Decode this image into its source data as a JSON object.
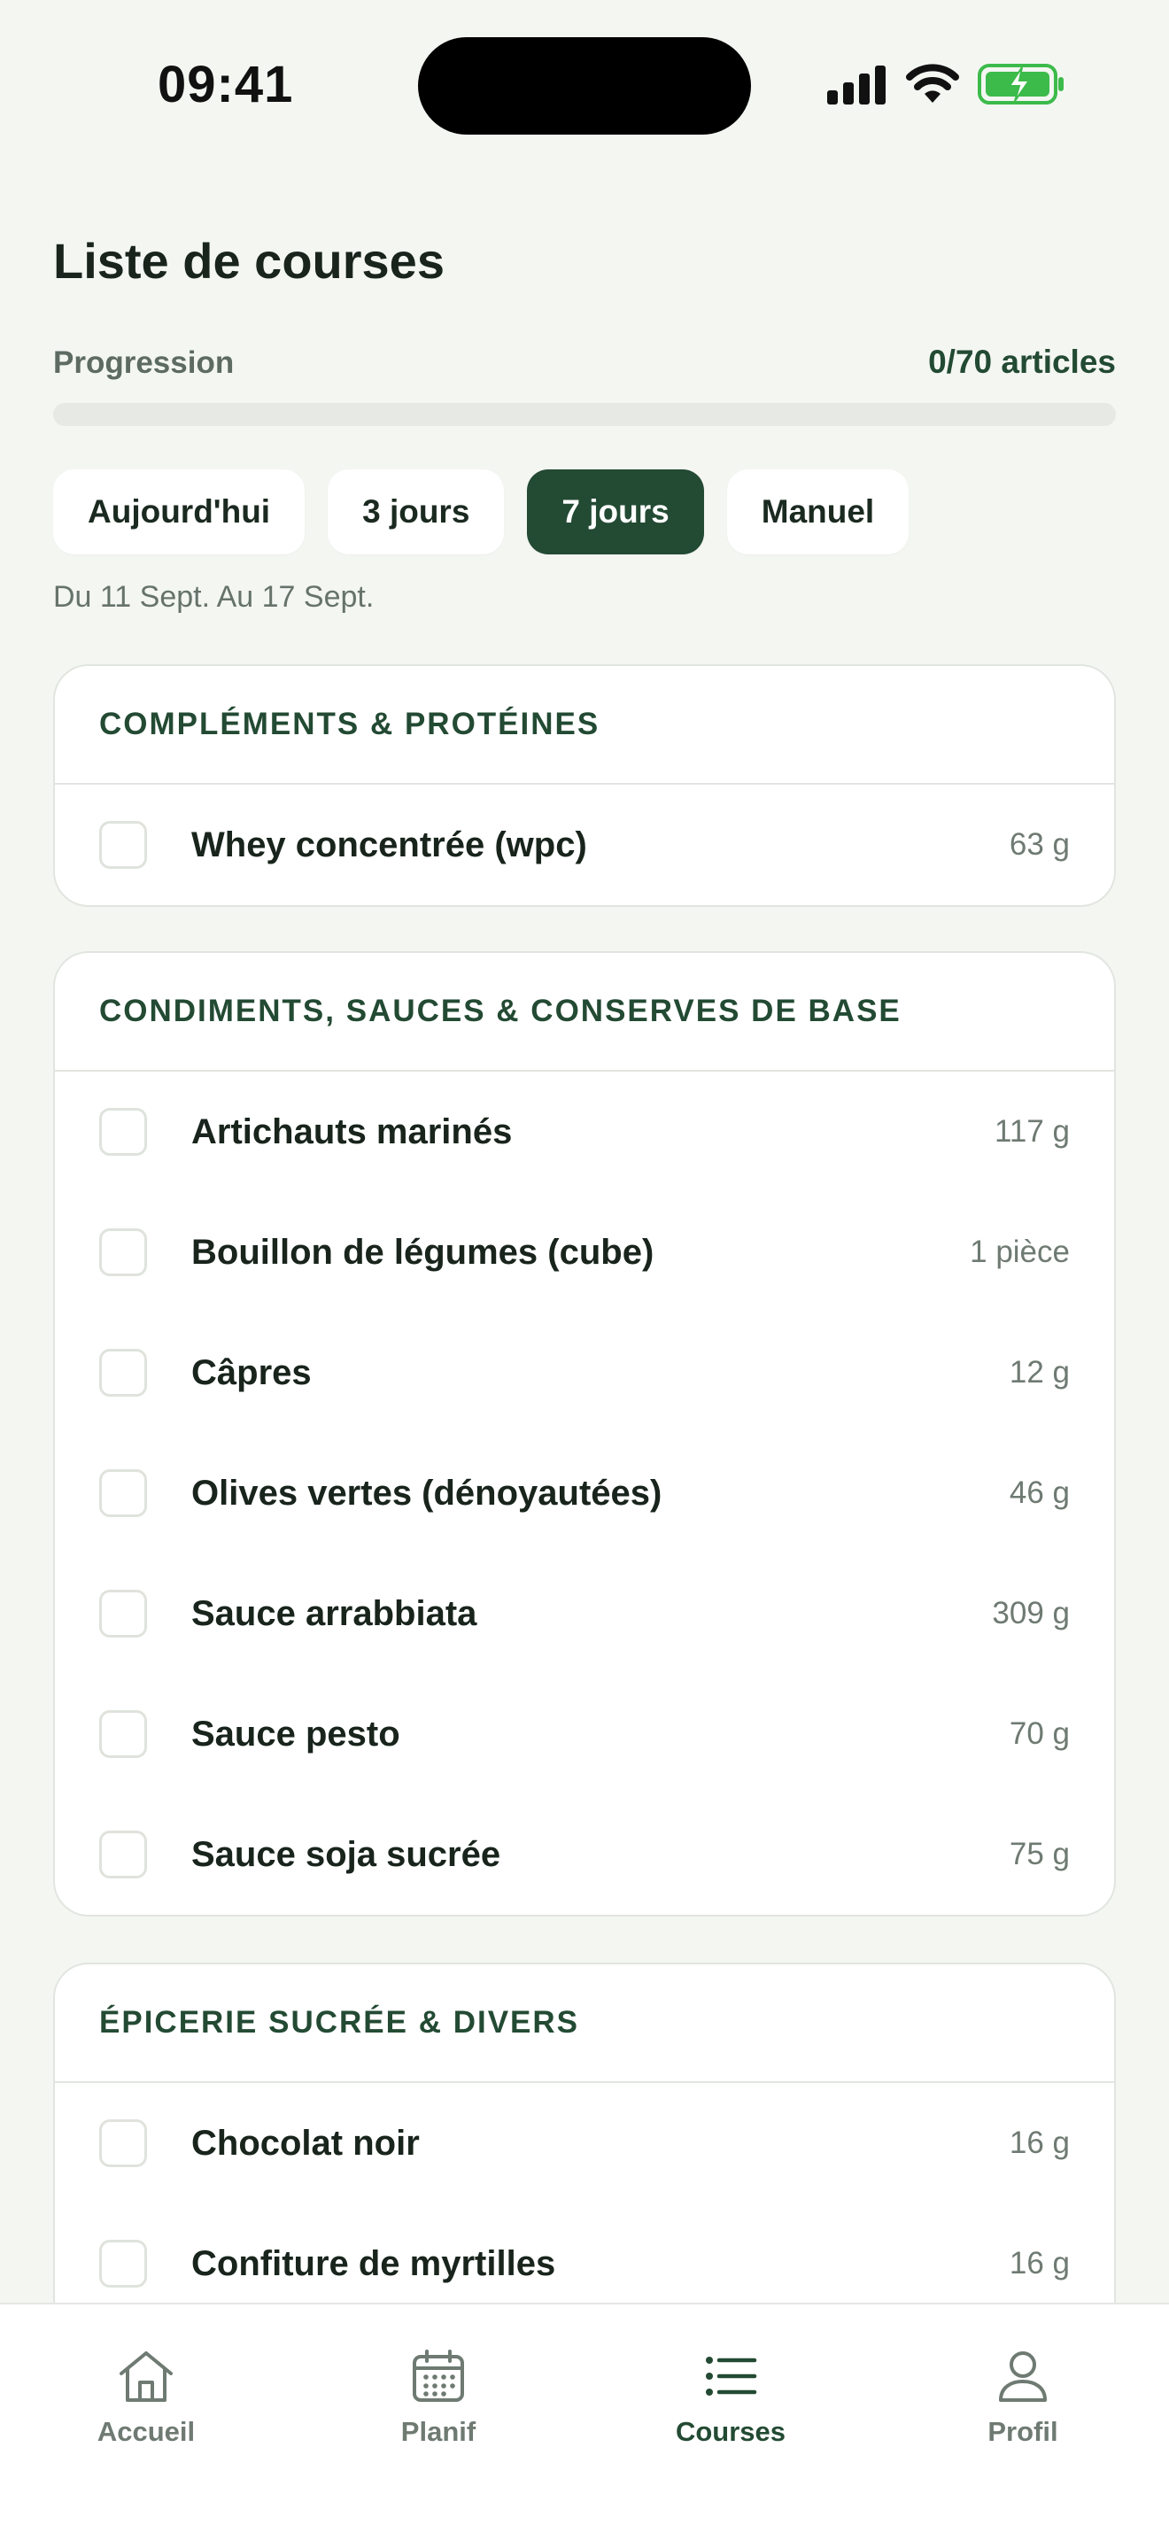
{
  "status_bar": {
    "time": "09:41"
  },
  "page": {
    "title": "Liste de courses"
  },
  "progress": {
    "label": "Progression",
    "count_text": "0/70 articles",
    "fraction": 0
  },
  "filters": {
    "chips": [
      "Aujourd'hui",
      "3 jours",
      "7 jours",
      "Manuel"
    ],
    "selected": "7 jours"
  },
  "date_range": "Du 11 Sept. Au 17 Sept.",
  "categories": [
    {
      "title": "COMPLÉMENTS & PROTÉINES",
      "items": [
        {
          "name": "Whey concentrée (wpc)",
          "qty": "63 g"
        }
      ]
    },
    {
      "title": "CONDIMENTS, SAUCES & CONSERVES DE BASE",
      "items": [
        {
          "name": "Artichauts marinés",
          "qty": "117 g"
        },
        {
          "name": "Bouillon de légumes (cube)",
          "qty": "1 pièce"
        },
        {
          "name": "Câpres",
          "qty": "12 g"
        },
        {
          "name": "Olives vertes (dénoyautées)",
          "qty": "46 g"
        },
        {
          "name": "Sauce arrabbiata",
          "qty": "309 g"
        },
        {
          "name": "Sauce pesto",
          "qty": "70 g"
        },
        {
          "name": "Sauce soja sucrée",
          "qty": "75 g"
        }
      ]
    },
    {
      "title": "ÉPICERIE SUCRÉE & DIVERS",
      "items": [
        {
          "name": "Chocolat noir",
          "qty": "16 g"
        },
        {
          "name": "Confiture de myrtilles",
          "qty": "16 g"
        }
      ]
    }
  ],
  "nav": {
    "items": [
      {
        "label": "Accueil",
        "icon": "home-icon"
      },
      {
        "label": "Planif",
        "icon": "calendar-icon"
      },
      {
        "label": "Courses",
        "icon": "list-icon"
      },
      {
        "label": "Profil",
        "icon": "user-icon"
      }
    ],
    "active": "Courses"
  },
  "colors": {
    "accent": "#234a33",
    "background": "#f4f6f2",
    "battery": "#3cbb4a"
  }
}
